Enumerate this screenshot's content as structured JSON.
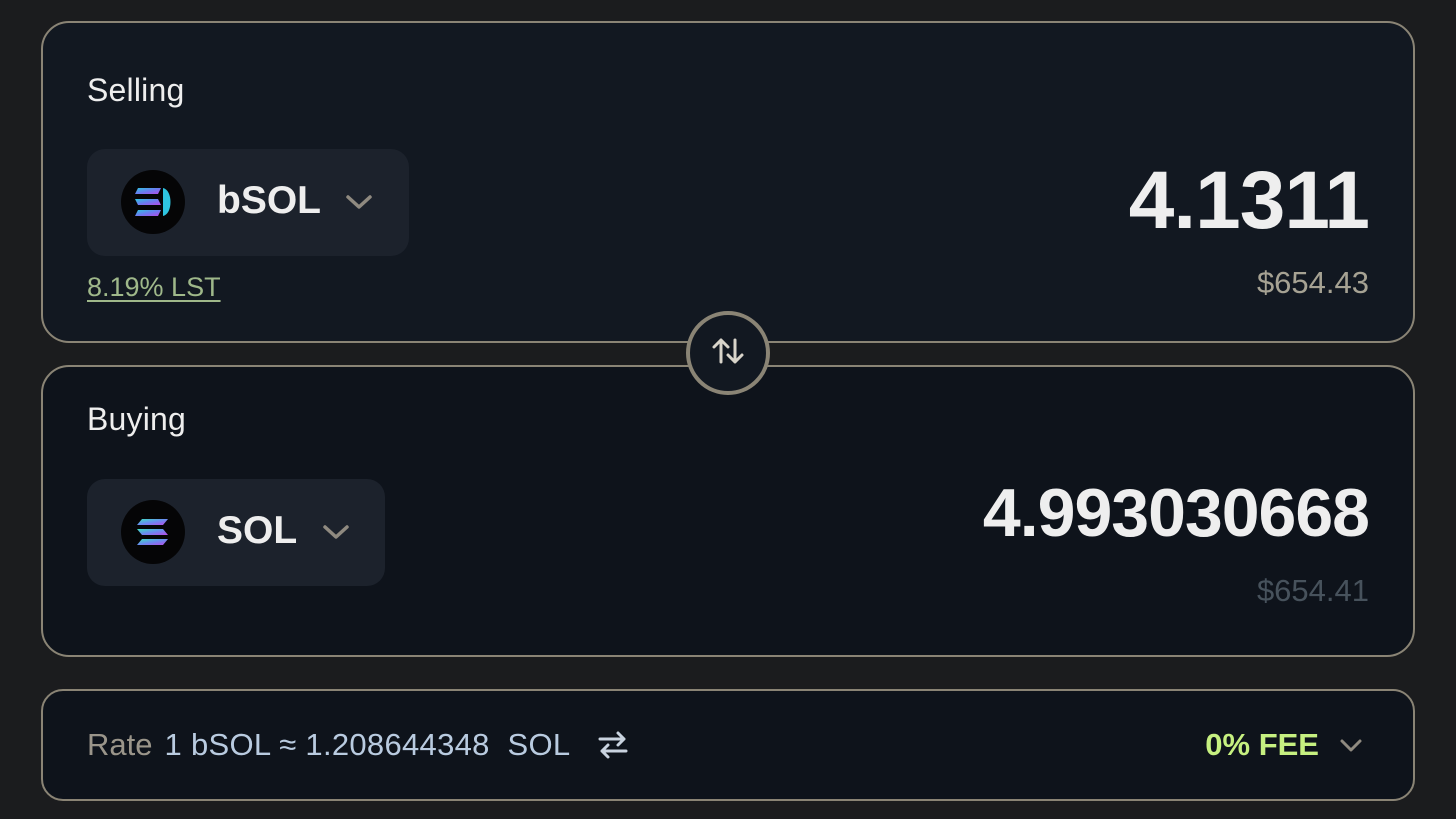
{
  "sell": {
    "label": "Selling",
    "token_symbol": "bSOL",
    "apy_link": "8.19% LST",
    "amount": "4.1311",
    "usd_value": "$654.43"
  },
  "buy": {
    "label": "Buying",
    "token_symbol": "SOL",
    "amount": "4.993030668",
    "usd_value": "$654.41"
  },
  "rate": {
    "label": "Rate",
    "value": "1 bSOL ≈ 1.208644348  SOL"
  },
  "fee": {
    "label": "0% FEE"
  },
  "colors": {
    "accent_fee": "#c6f080",
    "apy_link": "#9fb88a",
    "border": "#8a8475"
  },
  "icons": {
    "sell_token": "bsol-logo-icon",
    "buy_token": "sol-logo-icon",
    "flip": "swap-vertical-icon",
    "rate_toggle": "swap-horizontal-icon",
    "chevron": "chevron-down-icon"
  }
}
